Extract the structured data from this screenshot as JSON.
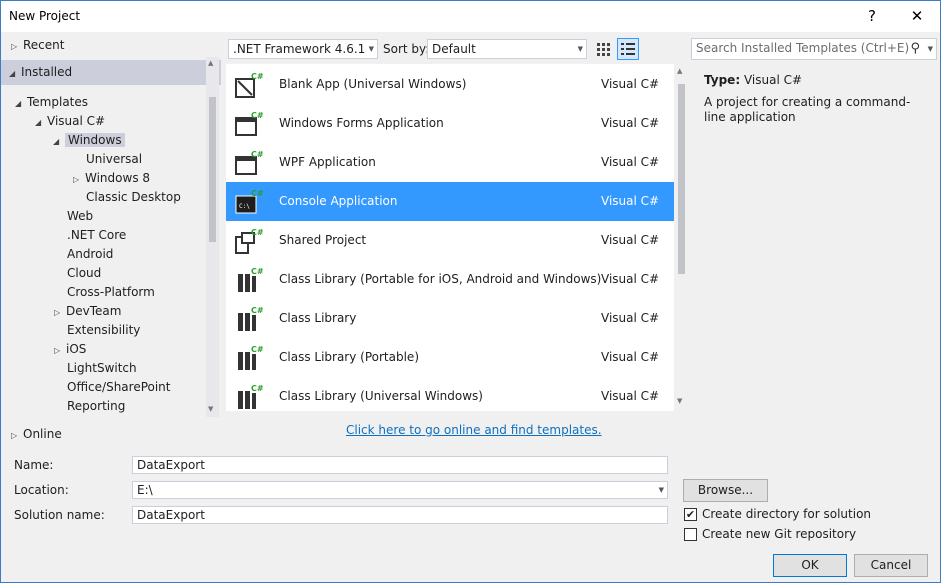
{
  "window": {
    "title": "New Project",
    "help_glyph": "?",
    "close_glyph": "✕"
  },
  "tree": {
    "recent": "Recent",
    "installed": "Installed",
    "templates": "Templates",
    "visual_csharp": "Visual C#",
    "windows": "Windows",
    "universal": "Universal",
    "windows8": "Windows 8",
    "classic_desktop": "Classic Desktop",
    "web": "Web",
    "net_core": ".NET Core",
    "android": "Android",
    "cloud": "Cloud",
    "cross_platform": "Cross-Platform",
    "devteam": "DevTeam",
    "extensibility": "Extensibility",
    "ios": "iOS",
    "lightswitch": "LightSwitch",
    "office_sharepoint": "Office/SharePoint",
    "reporting": "Reporting",
    "online": "Online"
  },
  "toolbar": {
    "framework": ".NET Framework 4.6.1",
    "sort_label": "Sort by:",
    "sort_value": "Default",
    "search_placeholder": "Search Installed Templates (Ctrl+E)"
  },
  "templates": [
    {
      "name": "Blank App (Universal Windows)",
      "lang": "Visual C#"
    },
    {
      "name": "Windows Forms Application",
      "lang": "Visual C#"
    },
    {
      "name": "WPF Application",
      "lang": "Visual C#"
    },
    {
      "name": "Console Application",
      "lang": "Visual C#"
    },
    {
      "name": "Shared Project",
      "lang": "Visual C#"
    },
    {
      "name": "Class Library (Portable for iOS, Android and Windows)",
      "lang": "Visual C#"
    },
    {
      "name": "Class Library",
      "lang": "Visual C#"
    },
    {
      "name": "Class Library (Portable)",
      "lang": "Visual C#"
    },
    {
      "name": "Class Library (Universal Windows)",
      "lang": "Visual C#"
    }
  ],
  "info": {
    "type_label": "Type:",
    "type_value": "Visual C#",
    "description": "A project for creating a command-line application"
  },
  "online_link": "Click here to go online and find templates.",
  "form": {
    "name_label": "Name:",
    "name_value": "DataExport",
    "location_label": "Location:",
    "location_value": "E:\\",
    "solution_label": "Solution name:",
    "solution_value": "DataExport",
    "browse": "Browse...",
    "create_dir": "Create directory for solution",
    "create_git": "Create new Git repository",
    "create_dir_checked": true,
    "create_git_checked": false,
    "ok": "OK",
    "cancel": "Cancel"
  },
  "colors": {
    "accent": "#3399ff",
    "link": "#0e70c0",
    "selection_gray": "#cccedb"
  }
}
